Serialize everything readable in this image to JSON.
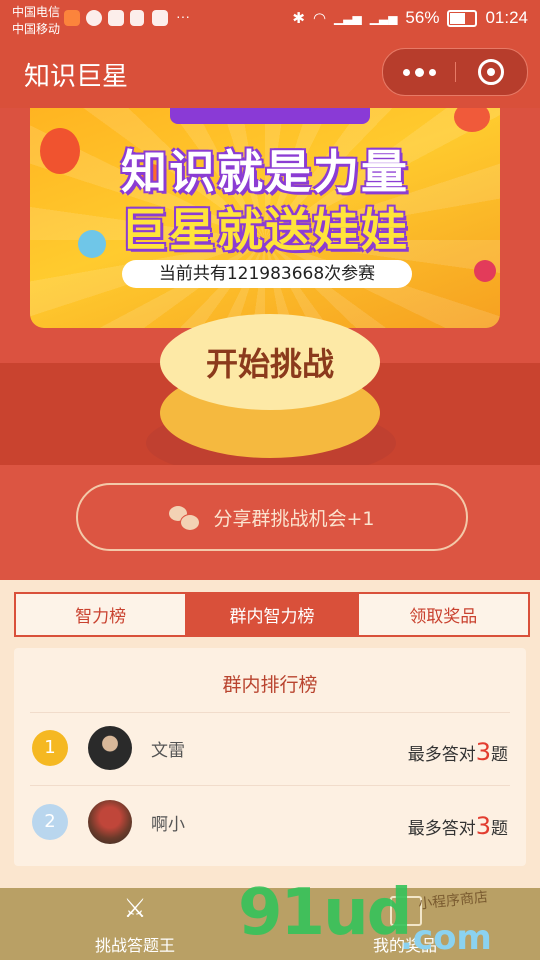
{
  "status_bar": {
    "carrier1": "中国电信",
    "carrier2": "中国移动",
    "battery": "56%",
    "time": "01:24",
    "battery_level": 0.56
  },
  "header": {
    "title": "知识巨星"
  },
  "banner": {
    "title_line1": "知识就是力量",
    "title_line2": "巨星就送娃娃",
    "count_text": "当前共有121983668次参赛"
  },
  "start_button": {
    "label": "开始挑战"
  },
  "share": {
    "label": "分享群挑战机会+1",
    "icon": "wechat-icon"
  },
  "tabs": [
    {
      "label": "智力榜",
      "active": false
    },
    {
      "label": "群内智力榜",
      "active": true
    },
    {
      "label": "领取奖品",
      "active": false
    }
  ],
  "ranking": {
    "title": "群内排行榜",
    "rows": [
      {
        "rank": "1",
        "name": "文雷",
        "score_prefix": "最多答对",
        "score": "3",
        "score_suffix": "题",
        "rank_color": "#f5b822"
      },
      {
        "rank": "2",
        "name": "啊小",
        "score_prefix": "最多答对",
        "score": "3",
        "score_suffix": "题",
        "rank_color": "#b9d6ee"
      }
    ]
  },
  "bottom_nav": [
    {
      "label": "挑战答题王",
      "icon": "crossed-swords-icon"
    },
    {
      "label": "我的奖品",
      "icon": "gift-icon"
    }
  ],
  "watermark": {
    "text": "91ud",
    "suffix": ".com",
    "cn": "小程序商店"
  },
  "colors": {
    "primary": "#d9503a",
    "page_bg": "#fbe6cf",
    "nav_bg": "#b9a065"
  }
}
